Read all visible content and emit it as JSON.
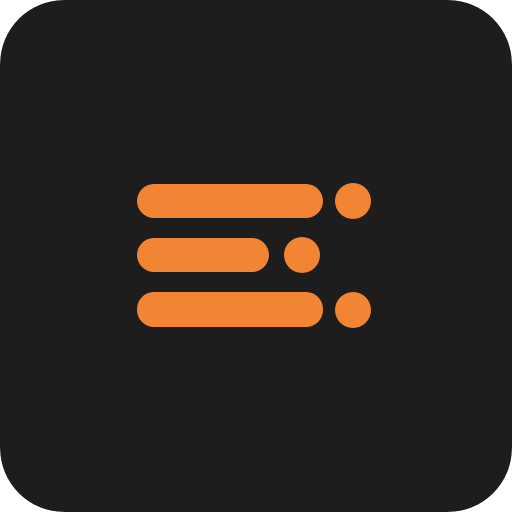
{
  "icon": {
    "name": "list-menu-icon",
    "colors": {
      "background": "#1d1d1d",
      "accent": "#f28534"
    }
  }
}
